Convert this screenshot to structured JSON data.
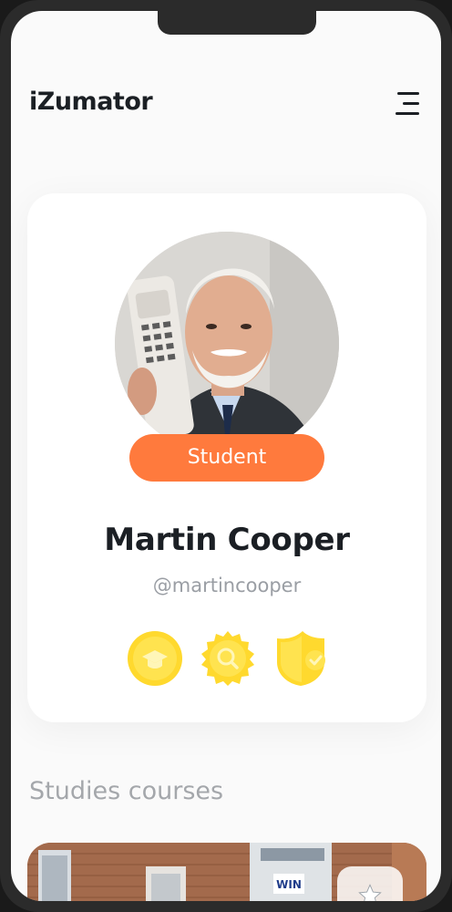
{
  "app": {
    "logo_text": "iZumator"
  },
  "header": {
    "menu_icon": "menu-icon"
  },
  "profile": {
    "role": "Student",
    "name": "Martin Cooper",
    "handle": "@martincooper",
    "achievements": [
      {
        "icon": "graduation-cap-badge-icon"
      },
      {
        "icon": "search-badge-icon"
      },
      {
        "icon": "check-shield-badge-icon"
      }
    ]
  },
  "courses": {
    "section_title": "Studies courses",
    "first_card": {
      "sign_text": "WIN",
      "fav_icon": "star-icon"
    }
  },
  "colors": {
    "accent_orange": "#ff7a3d",
    "badge_yellow": "#ffd92e",
    "text_dark": "#1b1f24",
    "text_muted": "#9a9ea4"
  }
}
